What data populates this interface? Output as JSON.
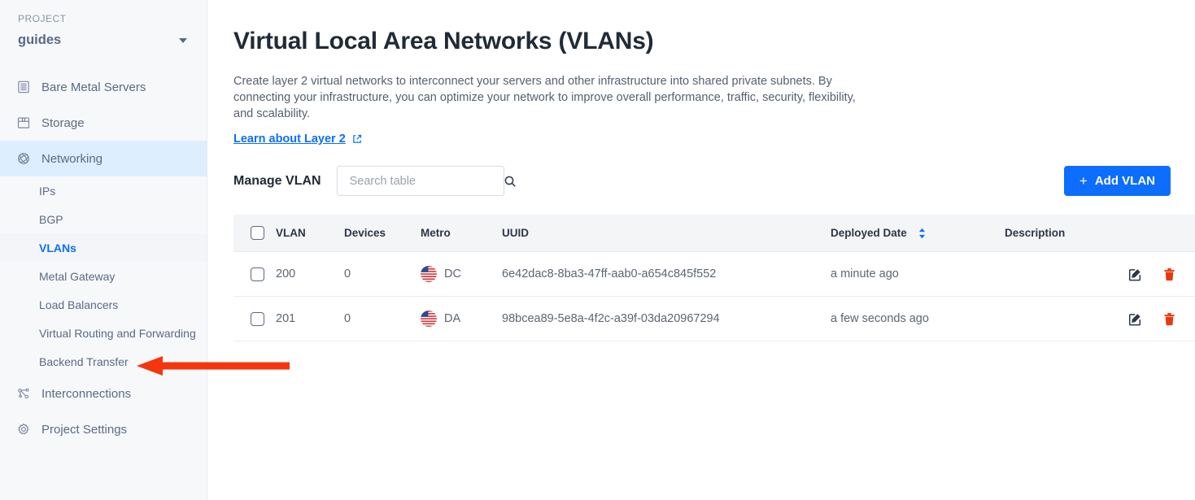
{
  "sidebar": {
    "project_label": "PROJECT",
    "project_name": "guides",
    "items": [
      {
        "label": "Bare Metal Servers",
        "icon": "server-icon",
        "active": false
      },
      {
        "label": "Storage",
        "icon": "storage-icon",
        "active": false
      },
      {
        "label": "Networking",
        "icon": "globe-icon",
        "active": true
      }
    ],
    "subitems": [
      {
        "label": "IPs",
        "active": false
      },
      {
        "label": "BGP",
        "active": false
      },
      {
        "label": "VLANs",
        "active": true
      },
      {
        "label": "Metal Gateway",
        "active": false
      },
      {
        "label": "Load Balancers",
        "active": false
      },
      {
        "label": "Virtual Routing and Forwarding",
        "active": false
      },
      {
        "label": "Backend Transfer",
        "active": false
      }
    ],
    "items_bottom": [
      {
        "label": "Interconnections",
        "icon": "interconnections-icon",
        "active": false
      },
      {
        "label": "Project Settings",
        "icon": "gear-icon",
        "active": false
      }
    ]
  },
  "main": {
    "title": "Virtual Local Area Networks (VLANs)",
    "description": "Create layer 2 virtual networks to interconnect your servers and other infrastructure into shared private subnets. By connecting your infrastructure, you can optimize your network to improve overall performance, traffic, security, flexibility, and scalability.",
    "learn_link": "Learn about Layer 2",
    "manage_label": "Manage VLAN",
    "search": {
      "value": "",
      "placeholder": "Search table"
    },
    "add_button": "Add VLAN"
  },
  "table": {
    "columns": [
      "VLAN",
      "Devices",
      "Metro",
      "UUID",
      "Deployed Date",
      "Description"
    ],
    "sorted_column": "Deployed Date",
    "rows": [
      {
        "vlan": "200",
        "devices": "0",
        "metro": "DC",
        "metro_flag": "us-flag-icon",
        "uuid": "6e42dac8-8ba3-47ff-aab0-a654c845f552",
        "deployed_date": "a minute ago",
        "description": ""
      },
      {
        "vlan": "201",
        "devices": "0",
        "metro": "DA",
        "metro_flag": "us-flag-icon",
        "uuid": "98bcea89-5e8a-4f2c-a39f-03da20967294",
        "deployed_date": "a few seconds ago",
        "description": ""
      }
    ]
  },
  "annotation": {
    "arrow": "red-left-arrow",
    "color": "#f4360e"
  },
  "colors": {
    "accent": "#0d6efd",
    "sidebar_bg": "#f7f8fa",
    "active_nav_bg": "#ddeeff",
    "title": "#212b36",
    "delete": "#e8380d"
  }
}
